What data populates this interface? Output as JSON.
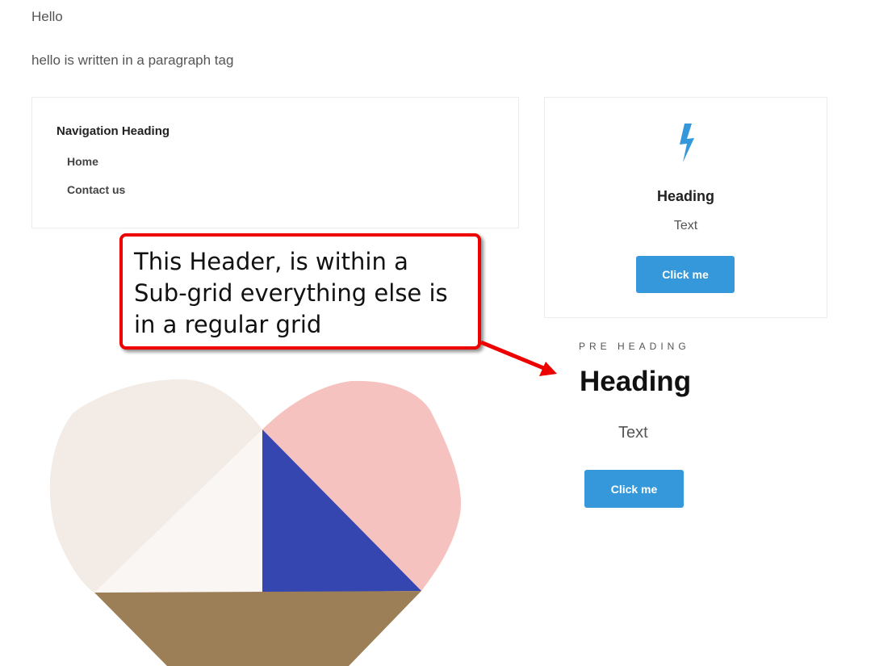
{
  "page": {
    "hello": "Hello",
    "paragraph": "hello is written in a paragraph tag"
  },
  "navigation": {
    "heading": "Navigation Heading",
    "links": [
      "Home",
      "Contact us"
    ]
  },
  "card": {
    "icon": "lightning-bolt-icon",
    "heading": "Heading",
    "text": "Text",
    "button_label": "Click me"
  },
  "annotation": {
    "text": "This Header, is within a Sub-grid everything else is in a regular grid",
    "border_color": "#ee0000"
  },
  "subgrid_header": {
    "pre_heading": "PRE HEADING",
    "heading": "Heading",
    "text": "Text",
    "button_label": "Click me"
  },
  "colors": {
    "accent": "#3498db",
    "heart_palette": [
      "#f2ebe6",
      "#f5c2bf",
      "#3646b0",
      "#faf6f4",
      "#9c7f56"
    ]
  }
}
